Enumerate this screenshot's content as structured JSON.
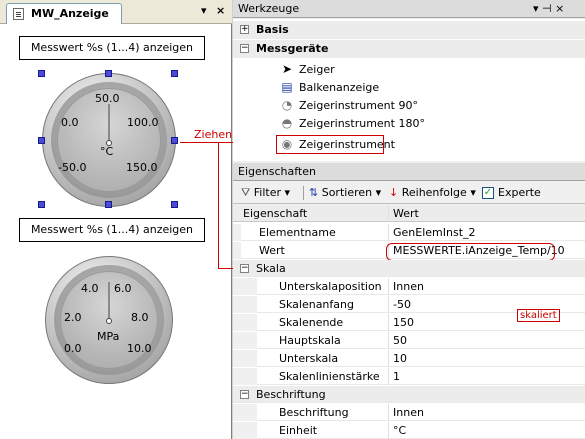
{
  "editor": {
    "tab_label": "MW_Anzeige",
    "tab_menu": "▾",
    "tab_close": "×",
    "label1": "Messwert %s (1...4) anzeigen",
    "label2": "Messwert %s (1...4) anzeigen",
    "gauge1": {
      "unit": "°C",
      "ticks": [
        "-50.0",
        "0.0",
        "50.0",
        "100.0",
        "150.0"
      ],
      "needle_value": 50.0
    },
    "gauge2": {
      "unit": "MPa",
      "ticks": [
        "0.0",
        "2.0",
        "4.0",
        "6.0",
        "8.0",
        "10.0"
      ],
      "needle_value": 5.0
    }
  },
  "annotations": {
    "drag": "Ziehen",
    "scaled": "skaliert",
    "color": "#cc0000"
  },
  "toolbox": {
    "title": "Werkzeuge",
    "pin": "▾ ⊣ ×",
    "groups": [
      {
        "label": "Basis",
        "expander": "+"
      },
      {
        "label": "Messgeräte",
        "expander": "−"
      }
    ],
    "items": [
      {
        "label": "Zeiger",
        "icon": "pointer-icon"
      },
      {
        "label": "Balkenanzeige",
        "icon": "bar-gauge-icon"
      },
      {
        "label": "Zeigerinstrument 90°",
        "icon": "gauge-90-icon"
      },
      {
        "label": "Zeigerinstrument 180°",
        "icon": "gauge-180-icon"
      },
      {
        "label": "Zeigerinstrument",
        "icon": "gauge-icon"
      }
    ]
  },
  "properties": {
    "title": "Eigenschaften",
    "pin": "▾ ⊣ ×",
    "toolbar": {
      "filter": "Filter",
      "sort": "Sortieren",
      "order": "Reihenfolge",
      "expert": "Experte",
      "expert_checked": true
    },
    "columns": {
      "name": "Eigenschaft",
      "value": "Wert"
    },
    "rows": [
      {
        "name": "Elementname",
        "value": "GenElemInst_2"
      },
      {
        "name": "Wert",
        "value": "MESSWERTE.iAnzeige_Temp/10"
      }
    ],
    "category_scale": {
      "label": "Skala",
      "expander": "−"
    },
    "scale_rows": [
      {
        "name": "Unterskalaposition",
        "value": "Innen"
      },
      {
        "name": "Skalenanfang",
        "value": "-50"
      },
      {
        "name": "Skalenende",
        "value": "150"
      },
      {
        "name": "Hauptskala",
        "value": "50"
      },
      {
        "name": "Unterskala",
        "value": "10"
      },
      {
        "name": "Skalenlinienstärke",
        "value": "1"
      }
    ],
    "category_label": {
      "label": "Beschriftung",
      "expander": "−"
    },
    "label_rows": [
      {
        "name": "Beschriftung",
        "value": "Innen"
      },
      {
        "name": "Einheit",
        "value": "°C"
      }
    ]
  }
}
